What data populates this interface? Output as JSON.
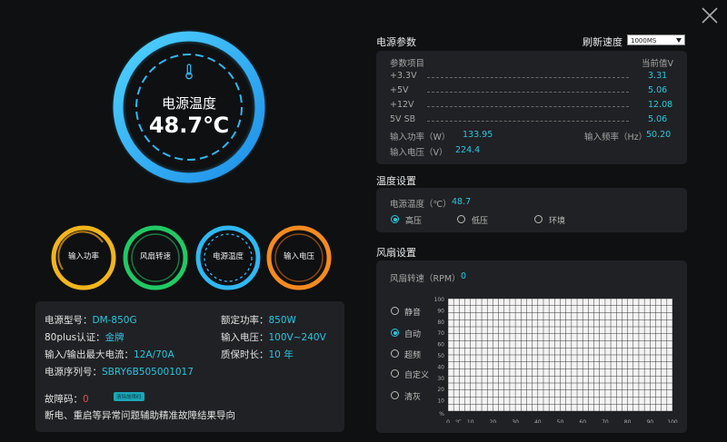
{
  "colors": {
    "accent": "#29c6e0",
    "ring_blue": "#2fb8f2",
    "ring_yellow": "#f2b51c",
    "ring_green": "#20c964",
    "ring_orange": "#f58a1f",
    "panel": "#202124",
    "bg": "#0f1012"
  },
  "temperature": {
    "label": "电源温度",
    "value": "48.7℃"
  },
  "gauges": [
    {
      "label": "输入功率",
      "color": "#f2b51c"
    },
    {
      "label": "风扇转速",
      "color": "#20c964"
    },
    {
      "label": "电源温度",
      "color": "#2fb8f2"
    },
    {
      "label": "输入电压",
      "color": "#f58a1f"
    }
  ],
  "info": {
    "model_label": "电源型号：",
    "model_value": "DM-850G",
    "rated_label": "额定功率：",
    "rated_value": "850W",
    "cert_label": "80plus认证：",
    "cert_value": "金牌",
    "voltage_label": "输入电压：",
    "voltage_value": "100V~240V",
    "current_label": "输入/输出最大电流：",
    "current_value": "12A/70A",
    "warranty_label": "质保时长：",
    "warranty_value": "10 年",
    "serial_label": "电源序列号：",
    "serial_value": "SBRY6B505001017",
    "fault_label": "故障码：",
    "fault_value": "0",
    "fault_tag": "清除故障码",
    "fault_note": "断电、重启等异常问题辅助精准故障结果导向"
  },
  "params": {
    "title": "电源参数",
    "refresh_label": "刷新速度",
    "refresh_value": "1000MS",
    "col_item": "参数项目",
    "col_value": "当前值V",
    "rows": [
      {
        "name": "+3.3V",
        "value": "3.31"
      },
      {
        "name": "+5V",
        "value": "5.06"
      },
      {
        "name": "+12V",
        "value": "12.08"
      },
      {
        "name": "5V SB",
        "value": "5.06"
      }
    ],
    "power_label": "输入功率（W）",
    "power_value": "133.95",
    "freq_label": "输入频率（Hz）",
    "freq_value": "50.20",
    "volt_label": "输入电压（V）",
    "volt_value": "224.4"
  },
  "temp_settings": {
    "title": "温度设置",
    "temp_label": "电源温度（℃）",
    "temp_value": "48.7",
    "options": [
      {
        "label": "高压",
        "selected": true
      },
      {
        "label": "低压",
        "selected": false
      },
      {
        "label": "环境",
        "selected": false
      }
    ]
  },
  "fan": {
    "title": "风扇设置",
    "speed_label": "风扇转速（RPM）",
    "speed_value": "0",
    "modes": [
      {
        "label": "静音",
        "selected": false
      },
      {
        "label": "自动",
        "selected": true
      },
      {
        "label": "超频",
        "selected": false
      },
      {
        "label": "自定义",
        "selected": false
      },
      {
        "label": "清灰",
        "selected": false
      }
    ]
  },
  "chart_data": {
    "type": "line",
    "x_ticks": [
      "0",
      "10",
      "20",
      "30",
      "40",
      "50",
      "60",
      "70",
      "80",
      "90",
      "100"
    ],
    "y_ticks": [
      "100",
      "90",
      "80",
      "70",
      "60",
      "50",
      "40",
      "30",
      "20",
      "10"
    ],
    "x_unit": "℃",
    "y_unit": "%",
    "xlim": [
      0,
      100
    ],
    "ylim": [
      0,
      100
    ],
    "grid": true,
    "series": []
  }
}
